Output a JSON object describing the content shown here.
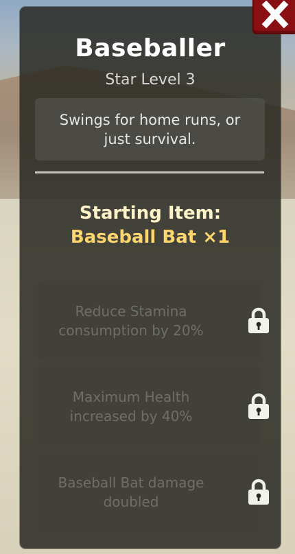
{
  "character": {
    "name": "Baseballer",
    "star_level": "Star Level 3",
    "description": "Swings for home runs, or just survival."
  },
  "starting_item": {
    "label": "Starting Item:",
    "value": "Baseball Bat ×1"
  },
  "perks": [
    {
      "text": "Reduce Stamina consumption by 20%",
      "locked": true,
      "icon": "lock-icon"
    },
    {
      "text": "Maximum Health increased by 40%",
      "locked": true,
      "icon": "lock-icon"
    },
    {
      "text": "Baseball Bat damage doubled",
      "locked": true,
      "icon": "lock-icon"
    }
  ],
  "close_icon": "close-icon",
  "colors": {
    "close_button": "#8a0f12",
    "title": "#ffffff",
    "starting_label": "#fff3c8",
    "starting_value": "#ffd66e",
    "locked_text": "#6f6f68"
  }
}
